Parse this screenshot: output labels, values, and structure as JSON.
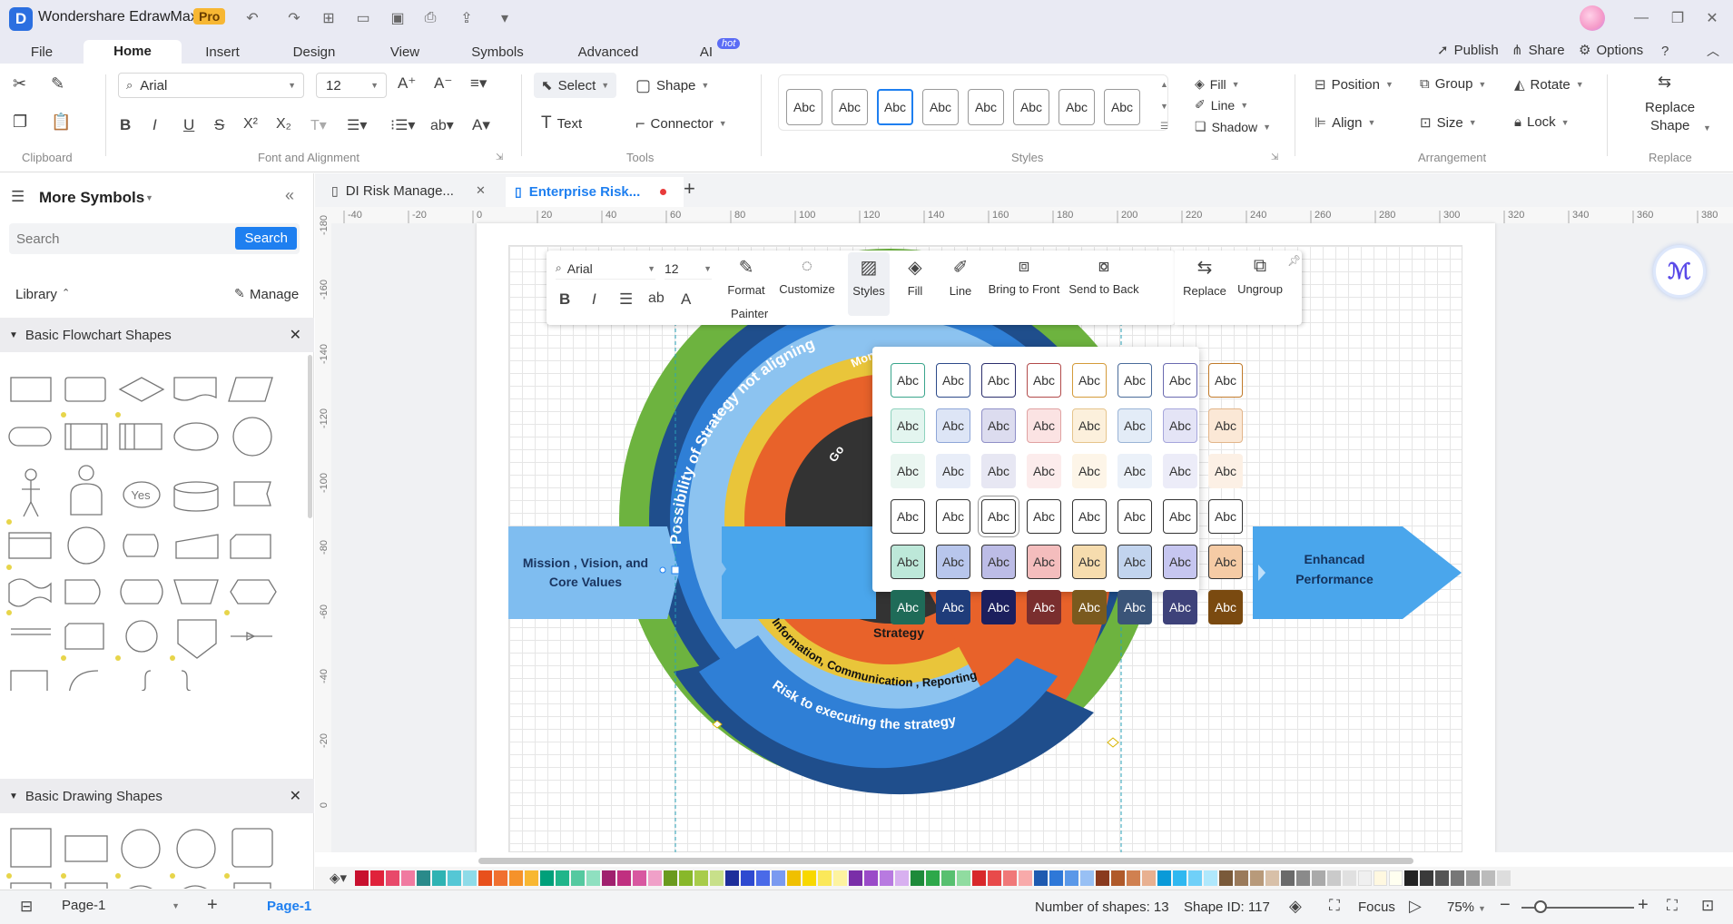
{
  "app": {
    "title": "Wondershare EdrawMax",
    "badge": "Pro"
  },
  "menu": {
    "tabs": [
      "File",
      "Home",
      "Insert",
      "Design",
      "View",
      "Symbols",
      "Advanced",
      "AI"
    ],
    "active": "Home",
    "ai_badge": "hot",
    "right": {
      "publish": "Publish",
      "share": "Share",
      "options": "Options"
    }
  },
  "ribbon": {
    "font_name": "Arial",
    "font_size": "12",
    "select": "Select",
    "shape": "Shape",
    "text": "Text",
    "connector": "Connector",
    "style_sample": "Abc",
    "fill": "Fill",
    "line": "Line",
    "shadow": "Shadow",
    "position": "Position",
    "group": "Group",
    "rotate": "Rotate",
    "align": "Align",
    "size": "Size",
    "lock": "Lock",
    "replace_shape_1": "Replace",
    "replace_shape_2": "Shape",
    "groups": {
      "clipboard": "Clipboard",
      "font": "Font and Alignment",
      "tools": "Tools",
      "styles": "Styles",
      "arrangement": "Arrangement",
      "replace": "Replace"
    }
  },
  "left": {
    "title": "More Symbols",
    "search_placeholder": "Search",
    "search_button": "Search",
    "library": "Library",
    "manage": "Manage",
    "section1": "Basic Flowchart Shapes",
    "section2": "Basic Drawing Shapes",
    "yes_label": "Yes"
  },
  "docs": {
    "tab1": "DI Risk Manage...",
    "tab2": "Enterprise Risk..."
  },
  "ruler": {
    "h": [
      "-40",
      "-20",
      "0",
      "20",
      "40",
      "60",
      "80",
      "100",
      "120",
      "140",
      "160",
      "180",
      "200",
      "220",
      "240",
      "260",
      "280",
      "300",
      "320",
      "340",
      "360",
      "380"
    ],
    "v": [
      "-180",
      "-160",
      "-140",
      "-120",
      "-100",
      "-80",
      "-60",
      "-40",
      "-20",
      "0"
    ]
  },
  "floating_toolbar": {
    "font": "Arial",
    "size": "12",
    "format_painter_1": "Format",
    "format_painter_2": "Painter",
    "customize": "Customize",
    "styles": "Styles",
    "fill": "Fill",
    "line": "Line",
    "bring_front": "Bring to Front",
    "send_back": "Send to Back",
    "replace": "Replace",
    "ungroup": "Ungroup"
  },
  "diagram": {
    "left_label_1": "Mission , Vision, and",
    "left_label_2": "Core Values",
    "right_label_1": "Enhancad",
    "right_label_2": "Performance",
    "outer_arc": "Possibility of Strategy not aligning",
    "monit": "Monit",
    "go": "Go",
    "strategy": "Strategy",
    "info": "Information, Communication , Reporting",
    "risk": "Risk to executing the strategy",
    "colors": {
      "green": "#6db33f",
      "navy": "#1f4e8c",
      "blue": "#2f7fd6",
      "light_blue": "#8cc3f0",
      "yellow": "#e9c53a",
      "orange": "#e8622a",
      "arrow_blue": "#4aa6ec"
    }
  },
  "style_palette": {
    "sample": "Abc",
    "rows": [
      {
        "fill": [
          "#fff",
          "#fff",
          "#fff",
          "#fff",
          "#fff",
          "#fff",
          "#fff",
          "#fff"
        ],
        "border": [
          "#3aa58c",
          "#2d4a8a",
          "#2c2f6d",
          "#b24a4a",
          "#d49b3a",
          "#4a6b9a",
          "#6a6ab0",
          "#c07a2a"
        ],
        "text": "#333"
      },
      {
        "fill": [
          "#e3f5ef",
          "#dde5f6",
          "#dcdcef",
          "#fbe3e3",
          "#fcf0dc",
          "#e3ecf7",
          "#e4e4f6",
          "#fbe8d6"
        ],
        "border": [
          "#8fd2be",
          "#8ea6d8",
          "#8f8fc7",
          "#e0a2a2",
          "#e6c48c",
          "#9ab4d6",
          "#a6a6dc",
          "#e2b58a"
        ],
        "text": "#333"
      },
      {
        "fill": [
          "#eaf6f1",
          "#e8edf8",
          "#e7e7f3",
          "#fcecec",
          "#fdf5e8",
          "#ebf1f9",
          "#ececf8",
          "#fcf0e5"
        ],
        "border": [
          "#eaf6f1",
          "#e8edf8",
          "#e7e7f3",
          "#fcecec",
          "#fdf5e8",
          "#ebf1f9",
          "#ececf8",
          "#fcf0e5"
        ],
        "text": "#333"
      },
      {
        "fill": [
          "#fff",
          "#fff",
          "#fff",
          "#fff",
          "#fff",
          "#fff",
          "#fff",
          "#fff"
        ],
        "border": [
          "#333",
          "#333",
          "#333",
          "#333",
          "#333",
          "#333",
          "#333",
          "#333"
        ],
        "text": "#333"
      },
      {
        "fill": [
          "#bde8d9",
          "#b8c6ec",
          "#bcbce6",
          "#f4bdbd",
          "#f6dcae",
          "#c2d4ee",
          "#c6c6f0",
          "#f5cba5"
        ],
        "border": [
          "#333",
          "#333",
          "#333",
          "#333",
          "#333",
          "#333",
          "#333",
          "#333"
        ],
        "text": "#333"
      },
      {
        "fill": [
          "#1f6b58",
          "#1f3c7a",
          "#1c1f5e",
          "#7a2e2e",
          "#7a5a1e",
          "#3a5478",
          "#3e427a",
          "#7a4a10"
        ],
        "border": [
          "#1f6b58",
          "#1f3c7a",
          "#1c1f5e",
          "#7a2e2e",
          "#7a5a1e",
          "#3a5478",
          "#3e427a",
          "#7a4a10"
        ],
        "text": "#fff"
      }
    ]
  },
  "palette_colors": [
    "#c8102e",
    "#e0223b",
    "#e8496a",
    "#f07aa0",
    "#2a8a8a",
    "#2fb3b3",
    "#55c7d5",
    "#8edbe8",
    "#e8501c",
    "#f07030",
    "#f5922a",
    "#f8b732",
    "#00a07a",
    "#20b58a",
    "#55c9a0",
    "#8fe0c0",
    "#a0206e",
    "#c03080",
    "#d858a0",
    "#f0a0c8",
    "#6a9a1e",
    "#88b82a",
    "#a8cc4a",
    "#c8e08a",
    "#1e2e9a",
    "#2e4ad0",
    "#4a6ae8",
    "#7a9af0",
    "#f0c000",
    "#f8d800",
    "#fbe85a",
    "#fdf3a0",
    "#7a2ea8",
    "#9a4ac8",
    "#b87ae0",
    "#d8b0f0",
    "#1e8a3a",
    "#2ea84a",
    "#58c070",
    "#90dca0",
    "#d8282a",
    "#e84a4a",
    "#f07878",
    "#f8aaaa",
    "#1e5ab0",
    "#2e78d8",
    "#5a98e8",
    "#98c0f4",
    "#8a3a1e",
    "#b05a2a",
    "#d08050",
    "#e8b090",
    "#0a9ad8",
    "#30b8f0",
    "#70d0f8",
    "#b0e8fc",
    "#7a5a3a",
    "#9a7a5a",
    "#b89a7a",
    "#d8c0a8",
    "#6a6a6a",
    "#8a8a8a",
    "#aaaaaa",
    "#cacaca",
    "#e0e0e0",
    "#f0f0f0",
    "#fff8e0",
    "#fffff0",
    "#222222",
    "#3a3a3a",
    "#555555",
    "#777777",
    "#999999",
    "#bbbbbb",
    "#dddddd"
  ],
  "status": {
    "page_selector": "Page-1",
    "page_tab": "Page-1",
    "shapes": "Number of shapes: 13",
    "shape_id": "Shape ID: 117",
    "focus": "Focus",
    "zoom": "75%"
  }
}
